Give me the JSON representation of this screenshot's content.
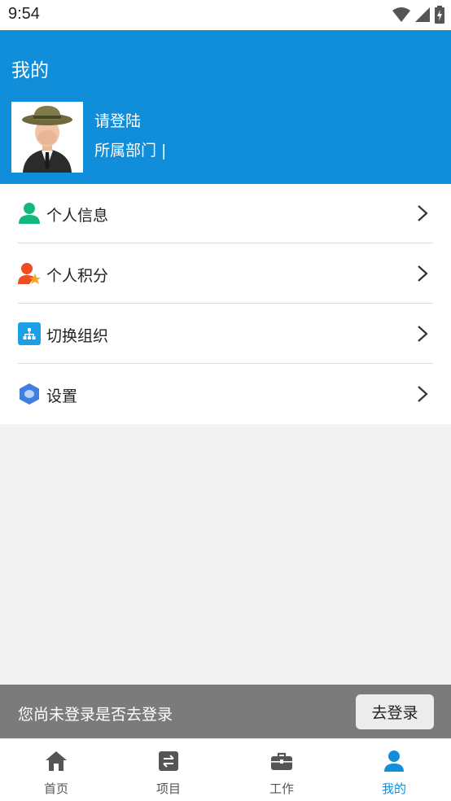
{
  "status_bar": {
    "time": "9:54"
  },
  "header": {
    "title": "我的",
    "login_prompt": "请登陆",
    "department": "所属部门 |"
  },
  "menu": {
    "items": [
      {
        "label": "个人信息",
        "icon": "person-icon",
        "color": "#14b87c"
      },
      {
        "label": "个人积分",
        "icon": "person-star-icon",
        "color": "#f04b23"
      },
      {
        "label": "切换组织",
        "icon": "org-chart-icon",
        "color": "#1ba0e6"
      },
      {
        "label": "设置",
        "icon": "settings-hexagon-icon",
        "color": "#3f7fe0"
      }
    ]
  },
  "login_banner": {
    "message": "您尚未登录是否去登录",
    "button_label": "去登录"
  },
  "tabbar": {
    "tabs": [
      {
        "label": "首页",
        "icon": "home-icon"
      },
      {
        "label": "项目",
        "icon": "project-icon"
      },
      {
        "label": "工作",
        "icon": "briefcase-icon"
      },
      {
        "label": "我的",
        "icon": "user-icon",
        "active": true
      }
    ]
  },
  "colors": {
    "primary": "#118ed9",
    "banner": "#7b7b7b",
    "tab_icon": "#555555"
  }
}
